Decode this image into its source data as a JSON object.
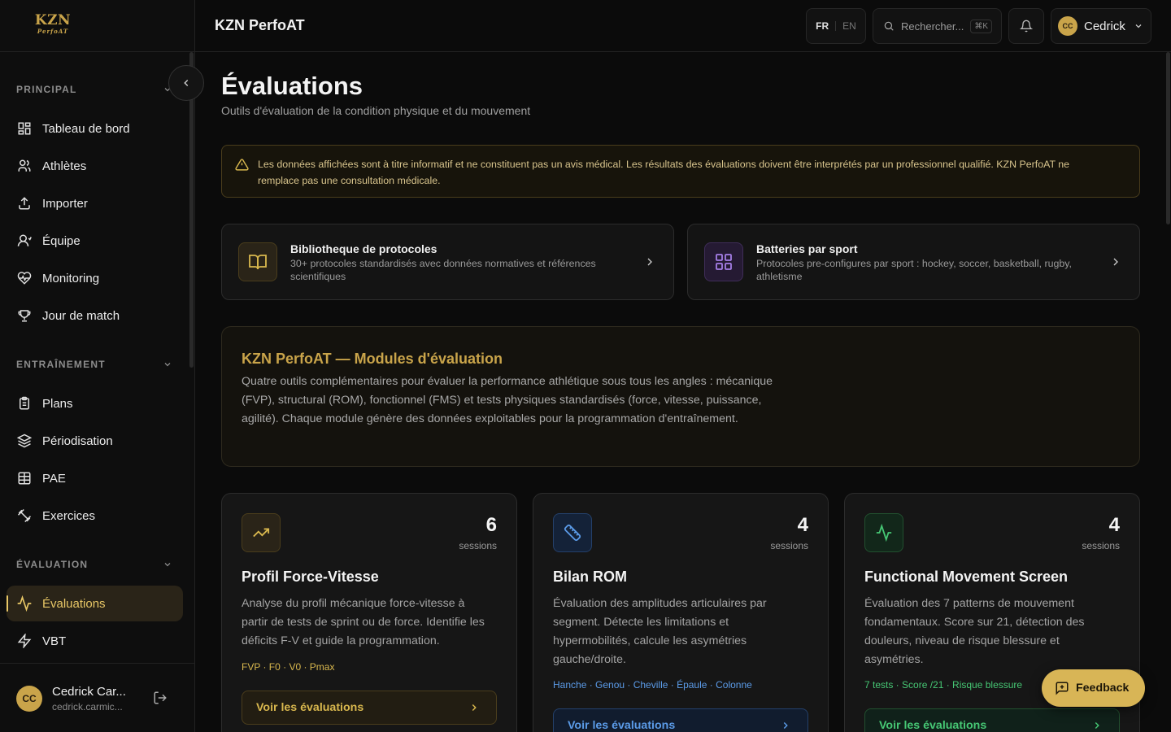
{
  "brand": {
    "logo_text": "KZN",
    "logo_sub": "PerfoAT",
    "app_title": "KZN PerfoAT",
    "accent": "#c9a44a"
  },
  "sidebar": {
    "sections": [
      {
        "label": "PRINCIPAL",
        "items": [
          "Tableau de bord",
          "Athlètes",
          "Importer",
          "Équipe",
          "Monitoring",
          "Jour de match"
        ]
      },
      {
        "label": "ENTRAÎNEMENT",
        "items": [
          "Plans",
          "Périodisation",
          "PAE",
          "Exercices"
        ]
      },
      {
        "label": "ÉVALUATION",
        "items": [
          "Évaluations",
          "VBT"
        ]
      }
    ],
    "active_item": "Évaluations",
    "user": {
      "initials": "CC",
      "name": "Cedrick Car...",
      "email": "cedrick.carmic..."
    }
  },
  "topbar": {
    "lang_active": "FR",
    "lang_other": "EN",
    "search_placeholder": "Rechercher...",
    "search_shortcut": "⌘K",
    "user_initials": "CC",
    "user_name": "Cedrick"
  },
  "page": {
    "title": "Évaluations",
    "subtitle": "Outils d'évaluation de la condition physique et du mouvement",
    "disclaimer": "Les données affichées sont à titre informatif et ne constituent pas un avis médical. Les résultats des évaluations doivent être interprétés par un professionnel qualifié. KZN PerfoAT ne remplace pas une consultation médicale."
  },
  "links": [
    {
      "title": "Bibliotheque de protocoles",
      "desc": "30+ protocoles standardisés avec données normatives et références scientifiques",
      "icon": "book-icon"
    },
    {
      "title": "Batteries par sport",
      "desc": "Protocoles pre-configures par sport : hockey, soccer, basketball, rugby, athletisme",
      "icon": "grid-icon"
    }
  ],
  "intro": {
    "title": "KZN PerfoAT — Modules d'évaluation",
    "text": "Quatre outils complémentaires pour évaluer la performance athlétique sous tous les angles : mécanique (FVP), structural (ROM), fonctionnel (FMS) et tests physiques standardisés (force, vitesse, puissance, agilité). Chaque module génère des données exploitables pour la programmation d'entraînement."
  },
  "modules": [
    {
      "count": "6",
      "unit": "sessions",
      "title": "Profil Force-Vitesse",
      "desc": "Analyse du profil mécanique force-vitesse à partir de tests de sprint ou de force. Identifie les déficits F-V et guide la programmation.",
      "tags": "FVP · F0 · V0 · Pmax",
      "button": "Voir les évaluations",
      "color": "#c9a44a",
      "icon": "trend-up-icon"
    },
    {
      "count": "4",
      "unit": "sessions",
      "title": "Bilan ROM",
      "desc": "Évaluation des amplitudes articulaires par segment. Détecte les limitations et hypermobilités, calcule les asymétries gauche/droite.",
      "tags": "Hanche · Genou · Cheville · Épaule · Colonne",
      "button": "Voir les évaluations",
      "color": "#4d8fe0",
      "icon": "ruler-icon"
    },
    {
      "count": "4",
      "unit": "sessions",
      "title": "Functional Movement Screen",
      "desc": "Évaluation des 7 patterns de mouvement fondamentaux. Score sur 21, détection des douleurs, niveau de risque blessure et asymétries.",
      "tags": "7 tests · Score /21 · Risque blessure",
      "button": "Voir les évaluations",
      "color": "#3fbf6a",
      "icon": "activity-icon"
    }
  ],
  "feedback_label": "Feedback"
}
